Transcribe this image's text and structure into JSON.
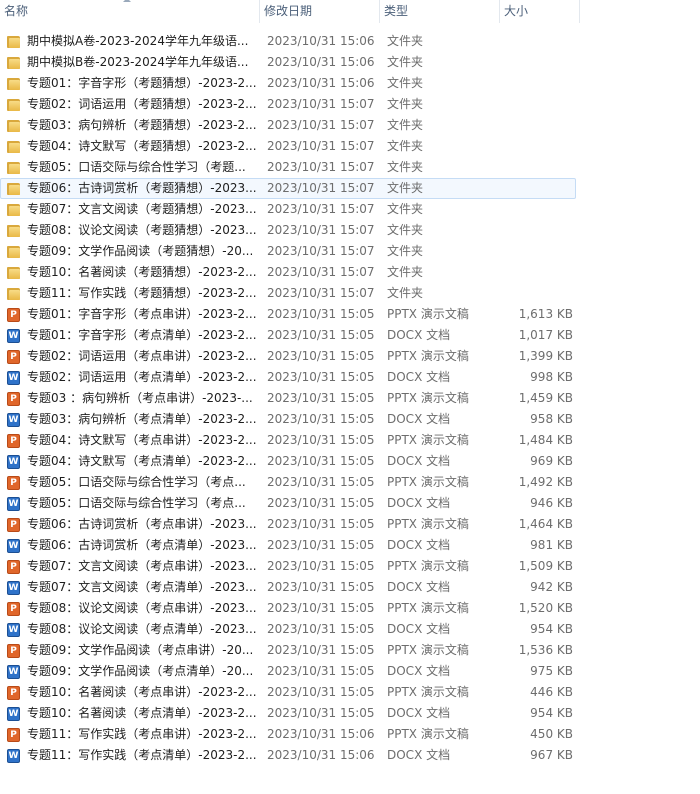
{
  "columns": {
    "name": "名称",
    "date": "修改日期",
    "type": "类型",
    "size": "大小"
  },
  "files": [
    {
      "icon": "folder",
      "name": "期中模拟A卷-2023-2024学年九年级语...",
      "date": "2023/10/31 15:06",
      "type": "文件夹",
      "size": ""
    },
    {
      "icon": "folder",
      "name": "期中模拟B卷-2023-2024学年九年级语...",
      "date": "2023/10/31 15:06",
      "type": "文件夹",
      "size": ""
    },
    {
      "icon": "folder",
      "name": "专题01：字音字形（考题猜想）-2023-2...",
      "date": "2023/10/31 15:06",
      "type": "文件夹",
      "size": ""
    },
    {
      "icon": "folder",
      "name": "专题02：词语运用（考题猜想）-2023-2...",
      "date": "2023/10/31 15:07",
      "type": "文件夹",
      "size": ""
    },
    {
      "icon": "folder",
      "name": "专题03：病句辨析（考题猜想）-2023-2...",
      "date": "2023/10/31 15:07",
      "type": "文件夹",
      "size": ""
    },
    {
      "icon": "folder",
      "name": "专题04：诗文默写（考题猜想）-2023-2...",
      "date": "2023/10/31 15:07",
      "type": "文件夹",
      "size": ""
    },
    {
      "icon": "folder",
      "name": "专题05：口语交际与综合性学习（考题...",
      "date": "2023/10/31 15:07",
      "type": "文件夹",
      "size": ""
    },
    {
      "icon": "folder",
      "name": "专题06：古诗词赏析（考题猜想）-2023...",
      "date": "2023/10/31 15:07",
      "type": "文件夹",
      "size": "",
      "selected": true
    },
    {
      "icon": "folder",
      "name": "专题07：文言文阅读（考题猜想）-2023...",
      "date": "2023/10/31 15:07",
      "type": "文件夹",
      "size": ""
    },
    {
      "icon": "folder",
      "name": "专题08：议论文阅读（考题猜想）-2023...",
      "date": "2023/10/31 15:07",
      "type": "文件夹",
      "size": ""
    },
    {
      "icon": "folder",
      "name": "专题09：文学作品阅读（考题猜想）-20...",
      "date": "2023/10/31 15:07",
      "type": "文件夹",
      "size": ""
    },
    {
      "icon": "folder",
      "name": "专题10：名著阅读（考题猜想）-2023-2...",
      "date": "2023/10/31 15:07",
      "type": "文件夹",
      "size": ""
    },
    {
      "icon": "folder",
      "name": "专题11：写作实践（考题猜想）-2023-2...",
      "date": "2023/10/31 15:07",
      "type": "文件夹",
      "size": ""
    },
    {
      "icon": "pptx",
      "name": "专题01：字音字形（考点串讲）-2023-2...",
      "date": "2023/10/31 15:05",
      "type": "PPTX 演示文稿",
      "size": "1,613 KB"
    },
    {
      "icon": "docx",
      "name": "专题01：字音字形（考点清单）-2023-2...",
      "date": "2023/10/31 15:05",
      "type": "DOCX 文档",
      "size": "1,017 KB"
    },
    {
      "icon": "pptx",
      "name": "专题02：词语运用（考点串讲）-2023-2...",
      "date": "2023/10/31 15:05",
      "type": "PPTX 演示文稿",
      "size": "1,399 KB"
    },
    {
      "icon": "docx",
      "name": "专题02：词语运用（考点清单）-2023-2...",
      "date": "2023/10/31 15:05",
      "type": "DOCX 文档",
      "size": "998 KB"
    },
    {
      "icon": "pptx",
      "name": "专题03 ：病句辨析（考点串讲）-2023-...",
      "date": "2023/10/31 15:05",
      "type": "PPTX 演示文稿",
      "size": "1,459 KB"
    },
    {
      "icon": "docx",
      "name": "专题03：病句辨析（考点清单）-2023-2...",
      "date": "2023/10/31 15:05",
      "type": "DOCX 文档",
      "size": "958 KB"
    },
    {
      "icon": "pptx",
      "name": "专题04：诗文默写（考点串讲）-2023-2...",
      "date": "2023/10/31 15:05",
      "type": "PPTX 演示文稿",
      "size": "1,484 KB"
    },
    {
      "icon": "docx",
      "name": "专题04：诗文默写（考点清单）-2023-2...",
      "date": "2023/10/31 15:05",
      "type": "DOCX 文档",
      "size": "969 KB"
    },
    {
      "icon": "pptx",
      "name": "专题05：口语交际与综合性学习（考点...",
      "date": "2023/10/31 15:05",
      "type": "PPTX 演示文稿",
      "size": "1,492 KB"
    },
    {
      "icon": "docx",
      "name": "专题05：口语交际与综合性学习（考点...",
      "date": "2023/10/31 15:05",
      "type": "DOCX 文档",
      "size": "946 KB"
    },
    {
      "icon": "pptx",
      "name": "专题06：古诗词赏析（考点串讲）-2023...",
      "date": "2023/10/31 15:05",
      "type": "PPTX 演示文稿",
      "size": "1,464 KB"
    },
    {
      "icon": "docx",
      "name": "专题06：古诗词赏析（考点清单）-2023...",
      "date": "2023/10/31 15:05",
      "type": "DOCX 文档",
      "size": "981 KB"
    },
    {
      "icon": "pptx",
      "name": "专题07：文言文阅读（考点串讲）-2023...",
      "date": "2023/10/31 15:05",
      "type": "PPTX 演示文稿",
      "size": "1,509 KB"
    },
    {
      "icon": "docx",
      "name": "专题07：文言文阅读（考点清单）-2023...",
      "date": "2023/10/31 15:05",
      "type": "DOCX 文档",
      "size": "942 KB"
    },
    {
      "icon": "pptx",
      "name": "专题08：议论文阅读（考点串讲）-2023...",
      "date": "2023/10/31 15:05",
      "type": "PPTX 演示文稿",
      "size": "1,520 KB"
    },
    {
      "icon": "docx",
      "name": "专题08：议论文阅读（考点清单）-2023...",
      "date": "2023/10/31 15:05",
      "type": "DOCX 文档",
      "size": "954 KB"
    },
    {
      "icon": "pptx",
      "name": "专题09：文学作品阅读（考点串讲）-20...",
      "date": "2023/10/31 15:05",
      "type": "PPTX 演示文稿",
      "size": "1,536 KB"
    },
    {
      "icon": "docx",
      "name": "专题09：文学作品阅读（考点清单）-20...",
      "date": "2023/10/31 15:05",
      "type": "DOCX 文档",
      "size": "975 KB"
    },
    {
      "icon": "pptx",
      "name": "专题10：名著阅读（考点串讲）-2023-2...",
      "date": "2023/10/31 15:05",
      "type": "PPTX 演示文稿",
      "size": "446 KB"
    },
    {
      "icon": "docx",
      "name": "专题10：名著阅读（考点清单）-2023-2...",
      "date": "2023/10/31 15:05",
      "type": "DOCX 文档",
      "size": "954 KB"
    },
    {
      "icon": "pptx",
      "name": "专题11：写作实践（考点串讲）-2023-2...",
      "date": "2023/10/31 15:06",
      "type": "PPTX 演示文稿",
      "size": "450 KB"
    },
    {
      "icon": "docx",
      "name": "专题11：写作实践（考点清单）-2023-2...",
      "date": "2023/10/31 15:06",
      "type": "DOCX 文档",
      "size": "967 KB"
    }
  ]
}
